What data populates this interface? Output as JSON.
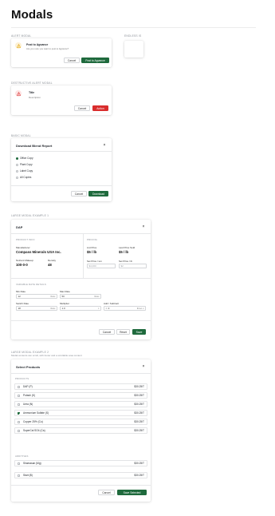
{
  "page": {
    "title": "Modals"
  },
  "alert_modal": {
    "section_label": "ALERT MODAL",
    "title": "Post to Agvance",
    "message": "Are you sure you want to post to Agvance?",
    "cancel_label": "Cancel",
    "confirm_label": "Post to Agvance"
  },
  "endless": {
    "section_label": "ENDLESS IS"
  },
  "destructive_modal": {
    "section_label": "DESTRUCTIVE ALERT MODAL",
    "title": "Title",
    "description": "Description",
    "cancel_label": "Cancel",
    "action_label": "Action"
  },
  "basic_modal": {
    "section_label": "BASIC MODAL",
    "title": "Download Blend Report",
    "options": [
      "Office Copy",
      "Plant Copy",
      "Label Copy",
      "All Copies"
    ],
    "selected_index": 0,
    "cancel_label": "Cancel",
    "download_label": "Download"
  },
  "large_modal_1": {
    "section_label": "LARGE MODAL EXAMPLE 1",
    "title": "DAP",
    "product_info_label": "PRODUCT INFO",
    "pricing_label": "PRICING",
    "manufacturer_label": "Manufacturer",
    "manufacturer_value": "Compass Minerals USA Inc.",
    "list_price_label": "List Price",
    "list_price_value": "$5 / lb",
    "last_price_label": "Last Price Sold",
    "last_price_value": "$5 / lb",
    "analysis_label": "Nutrient Makeup",
    "analysis_value": "100-0-0",
    "density_label": "Density",
    "density_value": "48",
    "set_price_ton_label": "Set Price / ton",
    "set_price_ton_placeholder": "$4,000",
    "set_price_lb_label": "Set Price / lb",
    "set_price_lb_placeholder": "$2",
    "variable_rate_label": "VARIABLE RATE DETAILS",
    "min_rate_label": "Min Rate",
    "min_rate_value": "12",
    "min_rate_unit": "lb/ac",
    "max_rate_label": "Max Rate",
    "max_rate_value": "50",
    "max_rate_unit": "lb/ac",
    "switch_rate_label": "Switch Rate",
    "switch_rate_value": "18",
    "switch_rate_unit": "lb/ac",
    "multiplier_label": "Multiplier",
    "multiplier_value": "1.0",
    "add_subtract_label": "Add / Subtract",
    "add_subtract_value": "0",
    "add_subtract_unit": "lb/ac",
    "cancel_label": "Cancel",
    "reset_label": "Reset",
    "save_label": "Save"
  },
  "large_modal_2": {
    "section_label": "LARGE MODAL EXAMPLE 2",
    "section_sub": "Modal contents can scroll, with footer and a scrollable area content",
    "title": "Select Products",
    "group_products": "PRODUCTS",
    "group_additives": "ADDITIVES",
    "products": [
      {
        "name": "DAP (P)",
        "price": "$30.25/T",
        "checked": false
      },
      {
        "name": "Potash (K)",
        "price": "$30.25/T",
        "checked": false
      },
      {
        "name": "Urea (N)",
        "price": "$30.25/T",
        "checked": false
      },
      {
        "name": "Ammonium Sulfate (S)",
        "price": "$30.25/T",
        "checked": true
      },
      {
        "name": "Copper 25% (Cu)",
        "price": "$30.25/T",
        "checked": false
      },
      {
        "name": "SuperCal SO4 (Ca)",
        "price": "$30.25/T",
        "checked": false
      }
    ],
    "additives": [
      {
        "name": "Shamasan (Mg)",
        "price": "$30.25/T",
        "checked": false
      },
      {
        "name": "Start (B)",
        "price": "$30.25/T",
        "checked": false
      }
    ],
    "cancel_label": "Cancel",
    "save_label": "Save Selected"
  },
  "colors": {
    "primary": "#1f6a3d",
    "danger": "#d92d2d",
    "warning": "#f1b11a"
  }
}
